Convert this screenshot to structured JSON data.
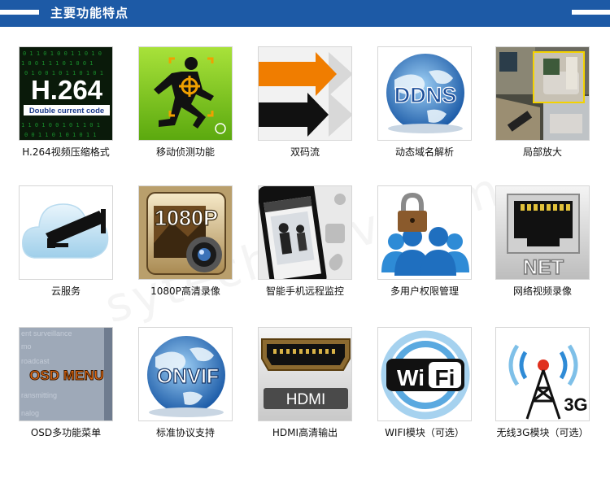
{
  "header": {
    "title": "主要功能特点"
  },
  "watermark": "sytechcctv.com",
  "features": [
    {
      "label": "H.264视频压缩格式",
      "thumb_text": "H.264",
      "thumb_subtext": "Double current code",
      "icon": "h264-icon"
    },
    {
      "label": "移动侦测功能",
      "icon": "running-man-icon"
    },
    {
      "label": "双码流",
      "icon": "dual-stream-arrows-icon"
    },
    {
      "label": "动态域名解析",
      "thumb_text": "DDNS",
      "icon": "ddns-globe-icon"
    },
    {
      "label": "局部放大",
      "icon": "zoom-room-icon"
    },
    {
      "label": "云服务",
      "icon": "cloud-camera-icon"
    },
    {
      "label": "1080P高清录像",
      "thumb_text": "1080P",
      "icon": "hd-1080p-icon"
    },
    {
      "label": "智能手机远程监控",
      "icon": "smartphone-icon"
    },
    {
      "label": "多用户权限管理",
      "icon": "multi-user-lock-icon"
    },
    {
      "label": "网络视频录像",
      "thumb_text": "NET",
      "icon": "network-port-icon"
    },
    {
      "label": "OSD多功能菜单",
      "thumb_text": "OSD  MENU",
      "icon": "osd-menu-icon"
    },
    {
      "label": "标准协议支持",
      "thumb_text": "ONVIF",
      "icon": "onvif-globe-icon"
    },
    {
      "label": "HDMI高清输出",
      "thumb_text": "HDMI",
      "icon": "hdmi-port-icon"
    },
    {
      "label": "WIFI模块（可选）",
      "thumb_text": "WiFi",
      "icon": "wifi-icon"
    },
    {
      "label": "无线3G模块（可选）",
      "thumb_text": "3G",
      "icon": "antenna-3g-icon"
    }
  ],
  "colors": {
    "header": "#1d5aa6",
    "accent_orange": "#f07d00",
    "bg": "#ffffff"
  }
}
